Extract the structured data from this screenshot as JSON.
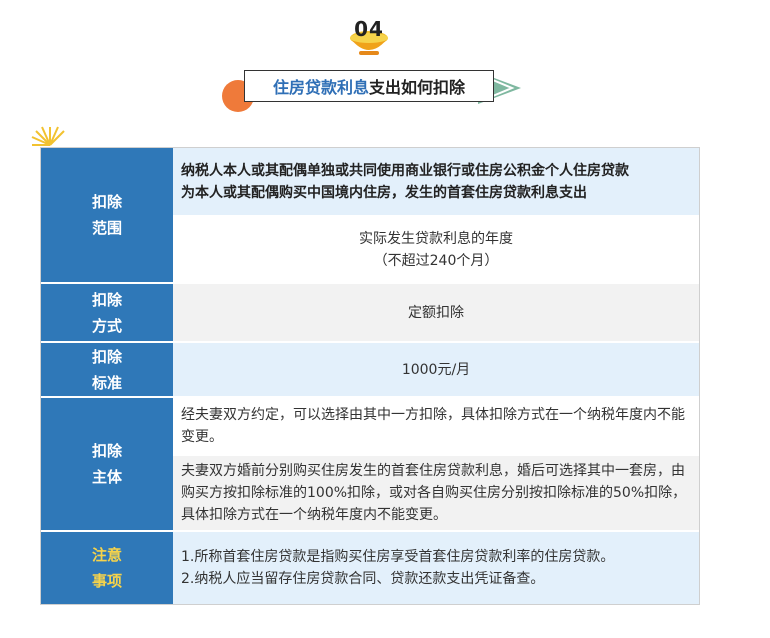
{
  "section": {
    "number": "04",
    "title_highlight": "住房贷款利息",
    "title_rest": "支出如何扣除"
  },
  "colors": {
    "label_bg": "#2f78b8",
    "highlight_text": "#2f6fb6",
    "note_label": "#f6d34b",
    "light_blue": "#e3f0fb"
  },
  "rows": {
    "scope": {
      "label1": "扣除",
      "label2": "范围",
      "line1": "纳税人本人或其配偶单独或共同使用商业银行或住房公积金个人住房贷款",
      "line2": "为本人或其配偶购买中国境内住房，发生的首套住房贷款利息支出",
      "period1": "实际发生贷款利息的年度",
      "period2": "（不超过240个月）"
    },
    "method": {
      "label1": "扣除",
      "label2": "方式",
      "value": "定额扣除"
    },
    "standard": {
      "label1": "扣除",
      "label2": "标准",
      "value": "1000元/月"
    },
    "subject": {
      "label1": "扣除",
      "label2": "主体",
      "text1": "经夫妻双方约定，可以选择由其中一方扣除，具体扣除方式在一个纳税年度内不能变更。",
      "text2": "夫妻双方婚前分别购买住房发生的首套住房贷款利息，婚后可选择其中一套房，由购买方按扣除标准的100%扣除，或对各自购买住房分别按扣除标准的50%扣除，具体扣除方式在一个纳税年度内不能变更。"
    },
    "notes": {
      "label1": "注意",
      "label2": "事项",
      "item1": "1.所称首套住房贷款是指购买住房享受首套住房贷款利率的住房贷款。",
      "item2": "2.纳税人应当留存住房贷款合同、贷款还款支出凭证备查。"
    }
  }
}
